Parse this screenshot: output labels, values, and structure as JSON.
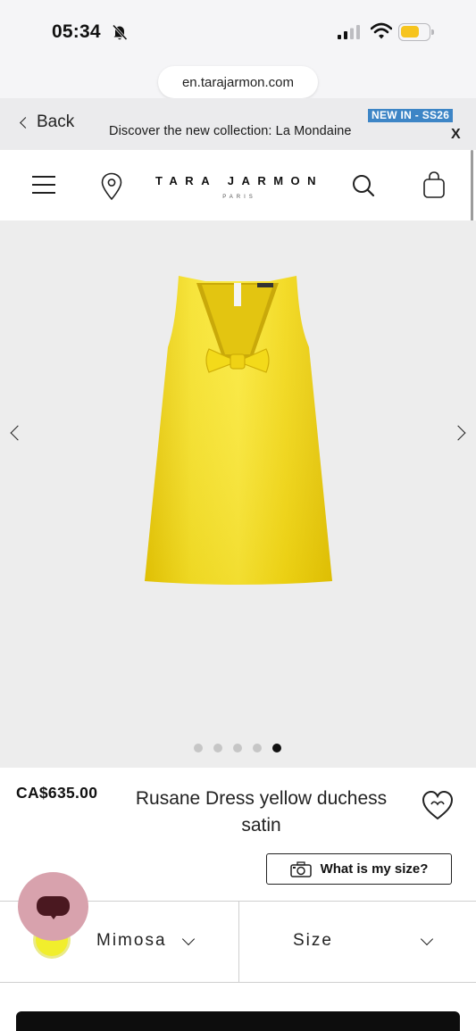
{
  "status_bar": {
    "time": "05:34"
  },
  "browser": {
    "url": "en.tarajarmon.com",
    "back_label": "Back"
  },
  "banner": {
    "badge": "NEW IN - SS26",
    "text": "Discover the new collection: La Mondaine",
    "close": "X"
  },
  "header": {
    "brand": "TARA JARMON",
    "brand_sub": "PARIS"
  },
  "gallery": {
    "slide_count": 5,
    "active_slide": 5
  },
  "product": {
    "price": "CA$635.00",
    "name": "Rusane Dress yellow duchess satin",
    "size_guide_label": "What is my size?"
  },
  "selectors": {
    "color_label": "Mimosa",
    "size_label": "Size"
  },
  "colors": {
    "accent_badge": "#3d85c6",
    "dress": "#f3dc1b",
    "chat": "#d8a2ad",
    "swatch": "#f1ee2c"
  },
  "icons": [
    "bell-slash",
    "signal",
    "wifi",
    "battery",
    "menu",
    "location-pin",
    "search",
    "shopping-bag",
    "heart",
    "camera",
    "chevron-left",
    "chevron-right",
    "chevron-down",
    "chat"
  ]
}
